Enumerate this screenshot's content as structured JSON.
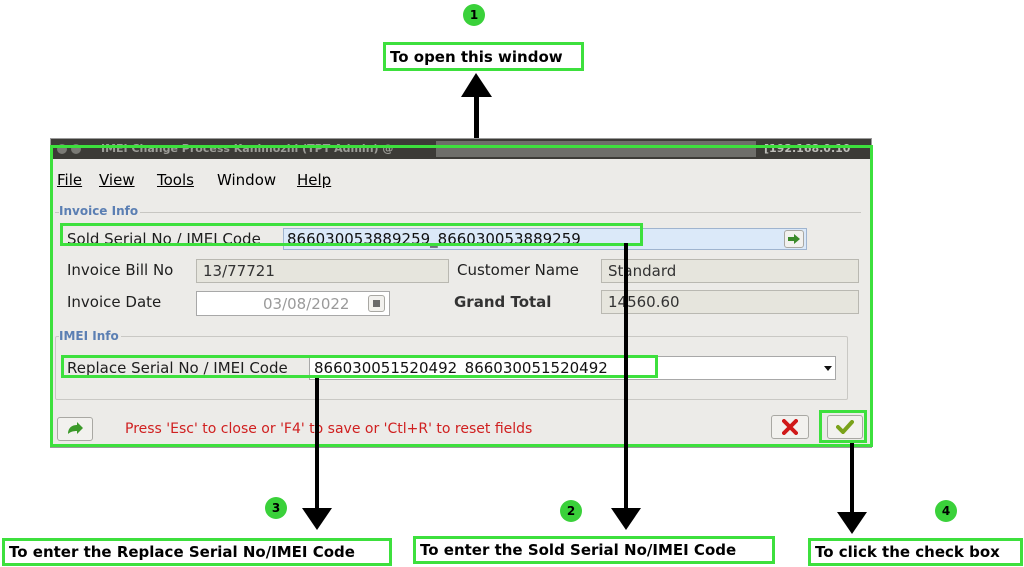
{
  "window": {
    "title": "IMEI Change Process  Kanimozhi (TPT Admin) @",
    "ip_text": "[192.168.0.10"
  },
  "menu": [
    {
      "label": "File"
    },
    {
      "label": "View"
    },
    {
      "label": "Tools"
    },
    {
      "label": "Window"
    },
    {
      "label": "Help"
    }
  ],
  "invoice_info": {
    "group_label": "Invoice Info",
    "sold_serial_label": "Sold Serial No / IMEI Code",
    "sold_serial_value": "866030053889259_866030053889259",
    "bill_no_label": "Invoice Bill No",
    "bill_no_value": "13/77721",
    "customer_label": "Customer Name",
    "customer_value": "Standard",
    "date_label": "Invoice Date",
    "date_value": "03/08/2022",
    "grand_total_label": "Grand Total",
    "grand_total_value": "14560.60"
  },
  "imei_info": {
    "group_label": "IMEI Info",
    "replace_serial_label": "Replace Serial No / IMEI Code",
    "replace_serial_value": "866030051520492_866030051520492"
  },
  "status_message": "Press 'Esc' to close or 'F4' to save or 'Ctl+R' to reset fields",
  "annotations": [
    {
      "number": "1",
      "text": "To open this window"
    },
    {
      "number": "2",
      "text": "To enter the Sold Serial No/IMEI Code"
    },
    {
      "number": "3",
      "text": "To enter the Replace Serial No/IMEI Code"
    },
    {
      "number": "4",
      "text": "To click the check box"
    }
  ],
  "colors": {
    "highlight": "#3de03d",
    "status_text": "#d02020",
    "group_label": "#5b7fb3"
  }
}
